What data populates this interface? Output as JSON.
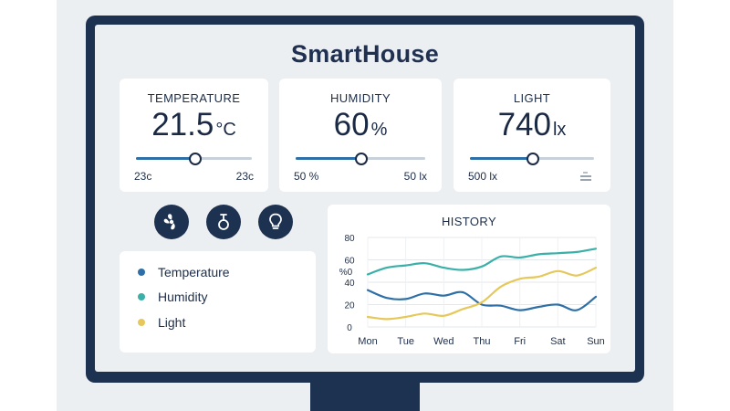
{
  "app": {
    "title": "SmartHouse"
  },
  "colors": {
    "navy": "#1d3150",
    "temperature": "#2d6fa6",
    "humidity": "#3ab0a8",
    "light": "#e6c85a"
  },
  "cards": [
    {
      "label": "TEMPERATURE",
      "value": "21.5",
      "unit": "°C",
      "min_label": "23c",
      "max_label": "23c",
      "level": 0.5
    },
    {
      "label": "HUMIDITY",
      "value": "60",
      "unit": "%",
      "min_label": "50 %",
      "max_label": "50 lx",
      "level": 0.5
    },
    {
      "label": "LIGHT",
      "value": "740",
      "unit": "lx",
      "min_label": "500 lx",
      "max_label": "",
      "level": 0.5
    }
  ],
  "controls": [
    {
      "icon": "fan-icon"
    },
    {
      "icon": "thermostat-icon"
    },
    {
      "icon": "lightbulb-icon"
    }
  ],
  "legend": [
    "Temperature",
    "Humidity",
    "Light"
  ],
  "chart_data": {
    "type": "line",
    "title": "HISTORY",
    "ylabel": "%0",
    "ylim": [
      0,
      80
    ],
    "yticks": [
      0,
      20,
      40,
      60,
      80
    ],
    "categories": [
      "Mon",
      "Tue",
      "Wed",
      "Thu",
      "Fri",
      "Sat",
      "Sun"
    ],
    "grid": true,
    "series": [
      {
        "name": "Temperature",
        "color": "#2d6fa6",
        "x": [
          0,
          0.5,
          1,
          1.5,
          2,
          2.5,
          3,
          3.5,
          4,
          4.5,
          5,
          5.5,
          6
        ],
        "values": [
          33,
          26,
          25,
          30,
          28,
          31,
          20,
          19,
          15,
          18,
          20,
          15,
          27
        ]
      },
      {
        "name": "Humidity",
        "color": "#3ab0a8",
        "x": [
          0,
          0.5,
          1,
          1.5,
          2,
          2.5,
          3,
          3.5,
          4,
          4.5,
          5,
          5.5,
          6
        ],
        "values": [
          47,
          53,
          55,
          57,
          53,
          51,
          54,
          63,
          62,
          65,
          66,
          67,
          70
        ]
      },
      {
        "name": "Light",
        "color": "#e6c85a",
        "x": [
          0,
          0.5,
          1,
          1.5,
          2,
          2.5,
          3,
          3.5,
          4,
          4.5,
          5,
          5.5,
          6
        ],
        "values": [
          9,
          7,
          9,
          12,
          10,
          16,
          22,
          36,
          43,
          45,
          50,
          46,
          53
        ]
      }
    ]
  }
}
